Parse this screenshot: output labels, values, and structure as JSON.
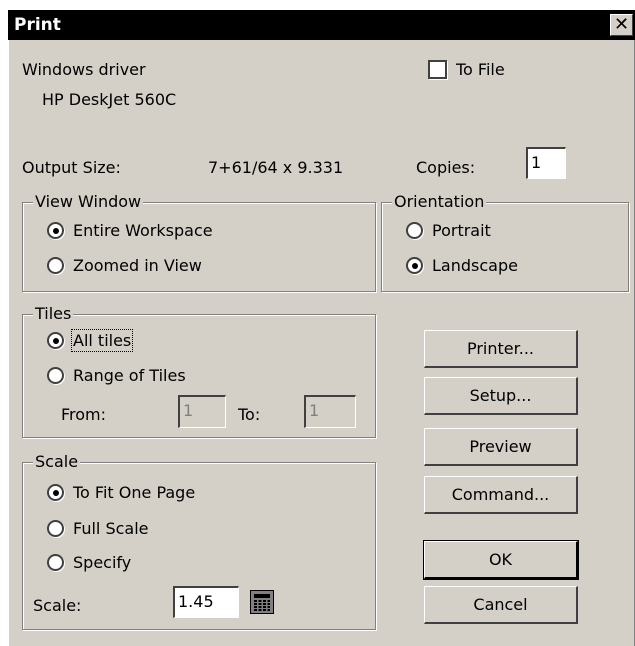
{
  "dialog": {
    "title": "Print",
    "close_symbol": "✕"
  },
  "driver": {
    "label": "Windows driver",
    "printer_name": "HP DeskJet 560C"
  },
  "to_file": {
    "label": "To File",
    "checked": false
  },
  "output_size": {
    "label": "Output Size:",
    "value": "7+61/64 x 9.331"
  },
  "copies": {
    "label": "Copies:",
    "value": "1"
  },
  "view_window": {
    "legend": "View Window",
    "options": [
      {
        "label": "Entire Workspace",
        "selected": true
      },
      {
        "label": "Zoomed in View",
        "selected": false
      }
    ]
  },
  "orientation": {
    "legend": "Orientation",
    "options": [
      {
        "label": "Portrait",
        "selected": false
      },
      {
        "label": "Landscape",
        "selected": true
      }
    ]
  },
  "tiles": {
    "legend": "Tiles",
    "options": [
      {
        "label": "All tiles",
        "selected": true
      },
      {
        "label": "Range of Tiles",
        "selected": false
      }
    ],
    "from_label": "From:",
    "from_value": "1",
    "to_label": "To:",
    "to_value": "1"
  },
  "scale": {
    "legend": "Scale",
    "options": [
      {
        "label": "To Fit One Page",
        "selected": true
      },
      {
        "label": "Full Scale",
        "selected": false
      },
      {
        "label": "Specify",
        "selected": false
      }
    ],
    "value_label": "Scale:",
    "value": "1.45",
    "calculator_icon": "calculator-icon"
  },
  "buttons": {
    "printer": "Printer...",
    "setup": "Setup...",
    "preview": "Preview",
    "command": "Command...",
    "ok": "OK",
    "cancel": "Cancel"
  },
  "colors": {
    "dialog_face": "#d4d0c8",
    "titlebar": "#000000"
  }
}
